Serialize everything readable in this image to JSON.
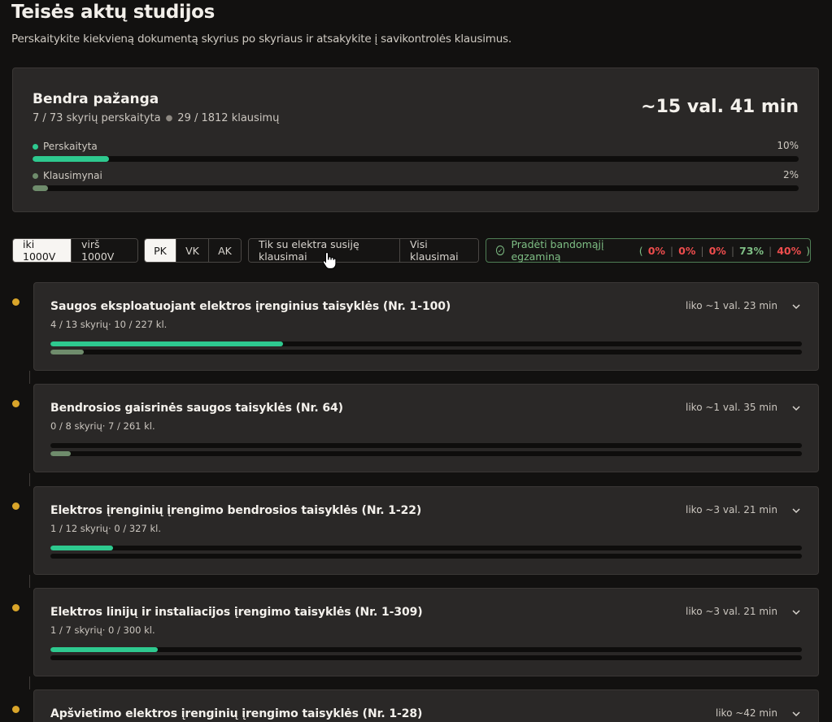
{
  "header": {
    "title": "Teisės aktų studijos",
    "subtitle": "Perskaitykite kiekvieną dokumentą skyrius po skyriaus ir atsakykite į savikontrolės klausimus."
  },
  "overall": {
    "title": "Bendra pažanga",
    "chapters_text": "7 / 73 skyrių perskaityta",
    "questions_text": "29 / 1812 klausimų",
    "time_left": "~15 val. 41 min",
    "read": {
      "label": "Perskaityta",
      "percent_label": "10%",
      "percent": 10
    },
    "questions": {
      "label": "Klausimynai",
      "percent_label": "2%",
      "percent": 2
    }
  },
  "filters": {
    "voltage": [
      {
        "label": "iki 1000V",
        "active": true
      },
      {
        "label": "virš 1000V",
        "active": false
      }
    ],
    "category": [
      {
        "label": "PK",
        "active": true
      },
      {
        "label": "VK",
        "active": false
      },
      {
        "label": "AK",
        "active": false
      }
    ],
    "question_scope": [
      {
        "label": "Tik su elektra susiję klausimai",
        "active": false
      },
      {
        "label": "Visi klausimai",
        "active": false
      }
    ],
    "exam": {
      "label": "Pradėti bandomąjį egzaminą",
      "scores": [
        {
          "value": "0%",
          "color": "red"
        },
        {
          "value": "0%",
          "color": "red"
        },
        {
          "value": "0%",
          "color": "red"
        },
        {
          "value": "73%",
          "color": "green"
        },
        {
          "value": "40%",
          "color": "red"
        }
      ]
    }
  },
  "documents": [
    {
      "title": "Saugos eksploatuojant elektros įrenginius taisyklės (Nr. 1-100)",
      "subtitle": "4 / 13 skyrių· 10 / 227 kl.",
      "remaining": "liko ~1 val. 23 min",
      "read_progress": 0.31,
      "question_progress": 0.044
    },
    {
      "title": "Bendrosios gaisrinės saugos taisyklės (Nr. 64)",
      "subtitle": "0 / 8 skyrių· 7 / 261 kl.",
      "remaining": "liko ~1 val. 35 min",
      "read_progress": 0,
      "question_progress": 0.027
    },
    {
      "title": "Elektros įrenginių įrengimo bendrosios taisyklės (Nr. 1-22)",
      "subtitle": "1 / 12 skyrių· 0 / 327 kl.",
      "remaining": "liko ~3 val. 21 min",
      "read_progress": 0.083,
      "question_progress": 0
    },
    {
      "title": "Elektros linijų ir instaliacijos įrengimo taisyklės (Nr. 1-309)",
      "subtitle": "1 / 7 skyrių· 0 / 300 kl.",
      "remaining": "liko ~3 val. 21 min",
      "read_progress": 0.143,
      "question_progress": 0
    },
    {
      "title": "Apšvietimo elektros įrenginių įrengimo taisyklės (Nr. 1-28)",
      "subtitle": "",
      "remaining": "liko ~42 min",
      "read_progress": 0,
      "question_progress": 0
    }
  ],
  "colors": {
    "accent_green": "#2ec98f",
    "question_bar": "#6f8c6c",
    "timeline_dot": "#d9a52a",
    "danger": "#ee4d4d",
    "exam_green": "#7fbf85"
  }
}
